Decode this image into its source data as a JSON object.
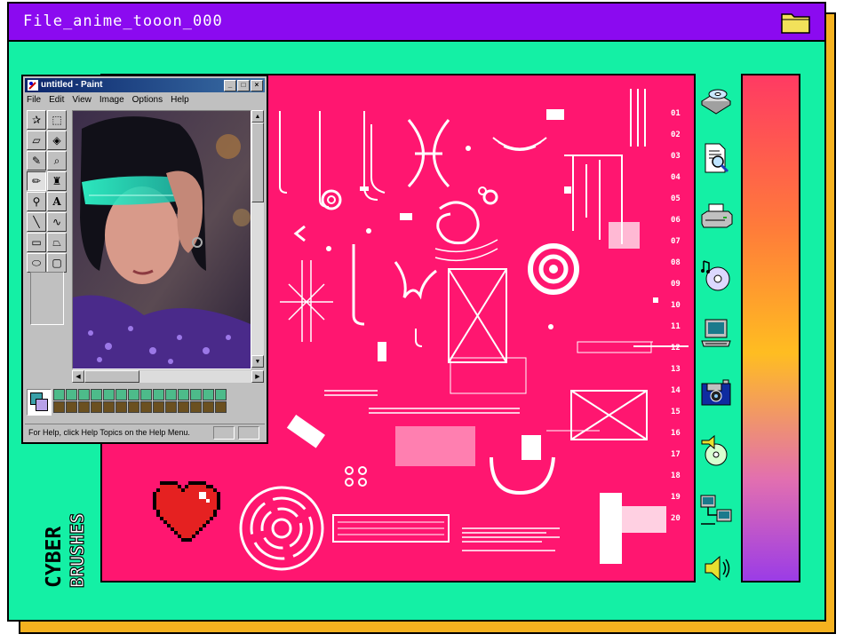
{
  "window": {
    "title": "File_anime_tooon_000",
    "folder_icon": "folder-icon"
  },
  "paint": {
    "title": "untitled - Paint",
    "controls": [
      "_",
      "□",
      "×"
    ],
    "menu": [
      "File",
      "Edit",
      "View",
      "Image",
      "Options",
      "Help"
    ],
    "tools": [
      "free-select",
      "rect-select",
      "eraser",
      "fill",
      "color-picker",
      "magnifier",
      "pencil",
      "brush",
      "airbrush",
      "text",
      "line",
      "curve",
      "rectangle",
      "polygon",
      "ellipse",
      "rounded-rect"
    ],
    "active_tool": "pencil",
    "status": "For Help, click Help Topics on the Help Menu.",
    "palette_row1": [
      "#4dbb8a",
      "#4dbb8a",
      "#4dbb8a",
      "#4dbb8a",
      "#4dbb8a",
      "#4dbb8a",
      "#4dbb8a",
      "#4dbb8a",
      "#4dbb8a",
      "#4dbb8a",
      "#4dbb8a",
      "#4dbb8a",
      "#4dbb8a",
      "#4dbb8a"
    ],
    "palette_row2": [
      "#6b5020",
      "#6b5020",
      "#6b5020",
      "#6b5020",
      "#6b5020",
      "#6b5020",
      "#6b5020",
      "#6b5020",
      "#6b5020",
      "#6b5020",
      "#6b5020",
      "#6b5020",
      "#6b5020",
      "#6b5020"
    ]
  },
  "ruler": [
    "01",
    "02",
    "03",
    "04",
    "05",
    "06",
    "07",
    "08",
    "09",
    "10",
    "11",
    "12",
    "13",
    "14",
    "15",
    "16",
    "17",
    "18",
    "19",
    "20"
  ],
  "desktop_icons": [
    "cd-drive-icon",
    "document-search-icon",
    "printer-icon",
    "music-cd-icon",
    "computer-icon",
    "camera-floppy-icon",
    "cd-speaker-icon",
    "network-icon",
    "speaker-icon"
  ],
  "logo": {
    "line1": "CYBER",
    "line2": "BRUSHES"
  },
  "colors": {
    "window_bg": "#14f0a5",
    "title_bar": "#8b0af0",
    "canvas": "#ff1670",
    "shadow": "#f5b21f",
    "heart": "#e52121"
  }
}
